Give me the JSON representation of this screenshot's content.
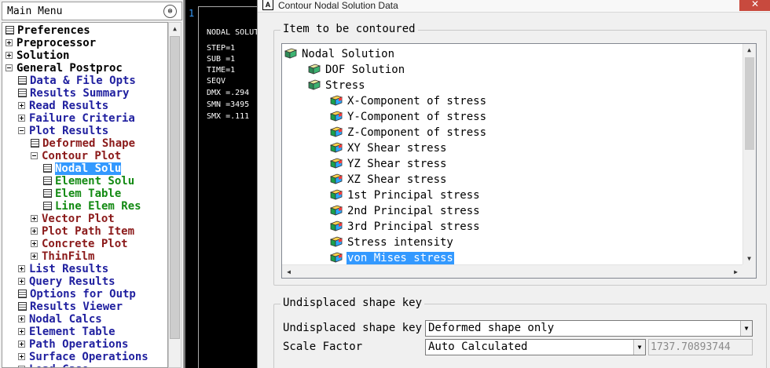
{
  "main_menu": {
    "title": "Main Menu",
    "collapse_glyph": "⊗",
    "items": [
      {
        "label": "Preferences",
        "toggle": "none",
        "icon": true,
        "color": "black"
      },
      {
        "label": "Preprocessor",
        "toggle": "plus",
        "icon": false,
        "color": "black"
      },
      {
        "label": "Solution",
        "toggle": "plus",
        "icon": false,
        "color": "black"
      },
      {
        "label": "General Postproc",
        "toggle": "minus",
        "icon": false,
        "color": "black"
      },
      {
        "label": "Data & File Opts",
        "toggle": "none",
        "icon": true,
        "color": "navy"
      },
      {
        "label": "Results Summary",
        "toggle": "none",
        "icon": true,
        "color": "navy"
      },
      {
        "label": "Read Results",
        "toggle": "plus",
        "icon": false,
        "color": "navy"
      },
      {
        "label": "Failure Criteria",
        "toggle": "plus",
        "icon": false,
        "color": "navy"
      },
      {
        "label": "Plot Results",
        "toggle": "minus",
        "icon": false,
        "color": "navy"
      },
      {
        "label": "Deformed Shape",
        "toggle": "none",
        "icon": true,
        "color": "maroon"
      },
      {
        "label": "Contour Plot",
        "toggle": "minus",
        "icon": false,
        "color": "maroon"
      },
      {
        "label": "Nodal Solu",
        "toggle": "none",
        "icon": true,
        "color": "green",
        "selected": true
      },
      {
        "label": "Element Solu",
        "toggle": "none",
        "icon": true,
        "color": "green"
      },
      {
        "label": "Elem Table",
        "toggle": "none",
        "icon": true,
        "color": "green"
      },
      {
        "label": "Line Elem Res",
        "toggle": "none",
        "icon": true,
        "color": "green"
      },
      {
        "label": "Vector Plot",
        "toggle": "plus",
        "icon": false,
        "color": "maroon"
      },
      {
        "label": "Plot Path Item",
        "toggle": "plus",
        "icon": false,
        "color": "maroon"
      },
      {
        "label": "Concrete Plot",
        "toggle": "plus",
        "icon": false,
        "color": "maroon"
      },
      {
        "label": "ThinFilm",
        "toggle": "plus",
        "icon": false,
        "color": "maroon"
      },
      {
        "label": "List Results",
        "toggle": "plus",
        "icon": false,
        "color": "navy"
      },
      {
        "label": "Query Results",
        "toggle": "plus",
        "icon": false,
        "color": "navy"
      },
      {
        "label": "Options for Outp",
        "toggle": "none",
        "icon": true,
        "color": "navy"
      },
      {
        "label": "Results Viewer",
        "toggle": "none",
        "icon": true,
        "color": "navy"
      },
      {
        "label": "Nodal Calcs",
        "toggle": "plus",
        "icon": false,
        "color": "navy"
      },
      {
        "label": "Element Table",
        "toggle": "plus",
        "icon": false,
        "color": "navy"
      },
      {
        "label": "Path Operations",
        "toggle": "plus",
        "icon": false,
        "color": "navy"
      },
      {
        "label": "Surface Operations",
        "toggle": "plus",
        "icon": false,
        "color": "navy"
      },
      {
        "label": "Load Case",
        "toggle": "plus",
        "icon": false,
        "color": "navy"
      }
    ]
  },
  "graphics": {
    "window_number": "1",
    "lines": [
      "NODAL SOLUTION",
      "",
      "STEP=1",
      "SUB =1",
      "TIME=1",
      "SEQV",
      "DMX =.294",
      "SMN =3495",
      "SMX =.111"
    ]
  },
  "dialog": {
    "title": "Contour Nodal Solution Data",
    "close_glyph": "✕",
    "contour_group_label": "Item to be contoured",
    "tree": [
      {
        "label": "Nodal Solution",
        "level": 0,
        "icon": "cube-folder"
      },
      {
        "label": "DOF Solution",
        "level": 1,
        "icon": "cube-folder"
      },
      {
        "label": "Stress",
        "level": 1,
        "icon": "cube-folder"
      },
      {
        "label": "X-Component of stress",
        "level": 2,
        "icon": "contour-cube"
      },
      {
        "label": "Y-Component of stress",
        "level": 2,
        "icon": "contour-cube"
      },
      {
        "label": "Z-Component of stress",
        "level": 2,
        "icon": "contour-cube"
      },
      {
        "label": "XY Shear stress",
        "level": 2,
        "icon": "contour-cube"
      },
      {
        "label": "YZ Shear stress",
        "level": 2,
        "icon": "contour-cube"
      },
      {
        "label": "XZ Shear stress",
        "level": 2,
        "icon": "contour-cube"
      },
      {
        "label": "1st Principal stress",
        "level": 2,
        "icon": "contour-cube"
      },
      {
        "label": "2nd Principal stress",
        "level": 2,
        "icon": "contour-cube"
      },
      {
        "label": "3rd Principal stress",
        "level": 2,
        "icon": "contour-cube"
      },
      {
        "label": "Stress intensity",
        "level": 2,
        "icon": "contour-cube"
      },
      {
        "label": "von Mises stress",
        "level": 2,
        "icon": "contour-cube",
        "selected": true
      }
    ],
    "shape_group_label": "Undisplaced shape key",
    "shape_key_label": "Undisplaced shape key",
    "shape_key_value": "Deformed shape only",
    "scale_factor_label": "Scale Factor",
    "scale_factor_value": "Auto Calculated",
    "scale_factor_number": "1737.70893744"
  }
}
